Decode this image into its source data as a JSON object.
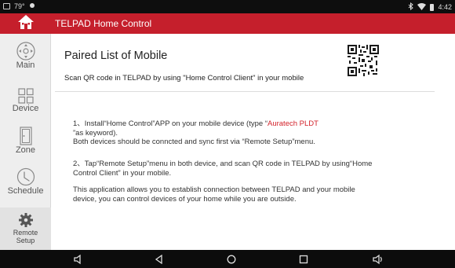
{
  "status_bar": {
    "left_icons": [
      "gallery-icon",
      "temperature-icon",
      "app-icon"
    ],
    "temperature": "79°",
    "right_icons": [
      "bluetooth-icon",
      "wifi-icon",
      "battery-icon"
    ],
    "time": "4:42"
  },
  "header": {
    "title": "TELPAD Home Control",
    "home_icon": "home-icon",
    "bg_color": "#c51f2c"
  },
  "sidebar": {
    "items": [
      {
        "label": "Main",
        "icon": "joystick-icon"
      },
      {
        "label": "Device",
        "icon": "grid-icon"
      },
      {
        "label": "Zone",
        "icon": "door-icon"
      },
      {
        "label": "Schedule",
        "icon": "clock-icon"
      },
      {
        "label": "Remote Setup",
        "label_line1": "Remote",
        "label_line2": "Setup",
        "icon": "gear-icon",
        "active": true
      }
    ]
  },
  "main": {
    "title": "Paired List of Mobile",
    "subtitle": "Scan QR code in TELPAD by using \"Home Control Client\" in your mobile",
    "step1_a": "1、Install“Home Control”APP on your mobile device (type “",
    "step1_red": "Auratech PLDT",
    "step1_b": "”as keyword).",
    "step1_c": "Both devices should be conncted and sync first via “Remote Setup”menu.",
    "step2": "2、Tap“Remote Setup”menu in both device, and scan QR code in TELPAD by using“Home Control Client” in your mobile.",
    "info": "This application allows you to establish connection between TELPAD and your mobile device, you can control devices of your home while you are outside.",
    "qr_icon": "qr-code-icon"
  },
  "nav_bar": {
    "buttons": [
      "volume-down-icon",
      "back-icon",
      "home-circle-icon",
      "recents-icon",
      "volume-up-icon"
    ]
  }
}
